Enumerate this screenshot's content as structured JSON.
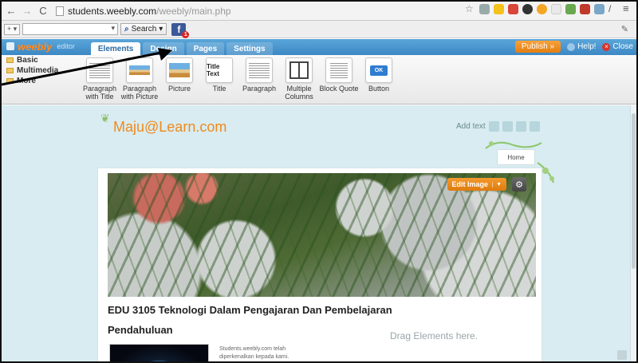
{
  "browser": {
    "url_host": "students.weebly.com",
    "url_path": "/weebly/main.php",
    "nav": {
      "back": "←",
      "forward": "→",
      "reload": "C"
    },
    "menu_icon": "≡"
  },
  "search_toolbar": {
    "add_label": "+ ▾",
    "dropdown": "▾",
    "search_label": "Search"
  },
  "editor": {
    "logo": "weebly",
    "logo_sub": "editor",
    "tabs": [
      {
        "label": "Elements",
        "active": true
      },
      {
        "label": "Design",
        "active": false
      },
      {
        "label": "Pages",
        "active": false
      },
      {
        "label": "Settings",
        "active": false
      }
    ],
    "publish": "Publish »",
    "help": "Help!",
    "close": "Close"
  },
  "categories": [
    "Basic",
    "Multimedia",
    "More"
  ],
  "elements": [
    {
      "label": "Paragraph with Title",
      "thumb": "lines"
    },
    {
      "label": "Paragraph with Picture",
      "thumb": "pic"
    },
    {
      "label": "Picture",
      "thumb": "pic"
    },
    {
      "label": "Title",
      "thumb": "ttext",
      "thumb_text": "Title Text"
    },
    {
      "label": "Paragraph",
      "thumb": "lines"
    },
    {
      "label": "Multiple Columns",
      "thumb": "cols"
    },
    {
      "label": "Block Quote",
      "thumb": "lines"
    },
    {
      "label": "Button",
      "thumb": "ok",
      "thumb_text": "OK"
    }
  ],
  "site": {
    "title": "Maju@Learn.com",
    "add_text": "Add text",
    "nav_home": "Home",
    "edit_image": "Edit Image",
    "post_title": "EDU 3105 Teknologi Dalam Pengajaran Dan Pembelajaran",
    "section_title": "Pendahuluan",
    "drag_hint": "Drag Elements here.",
    "paragraph": "Students.weebly.com telah diperkenalkan kepada kami."
  },
  "colors": {
    "weebly_blue": "#3d88c4",
    "publish_orange": "#e57d0f",
    "site_title_orange": "#f08a1c",
    "canvas_bg": "#d8ecf1"
  }
}
